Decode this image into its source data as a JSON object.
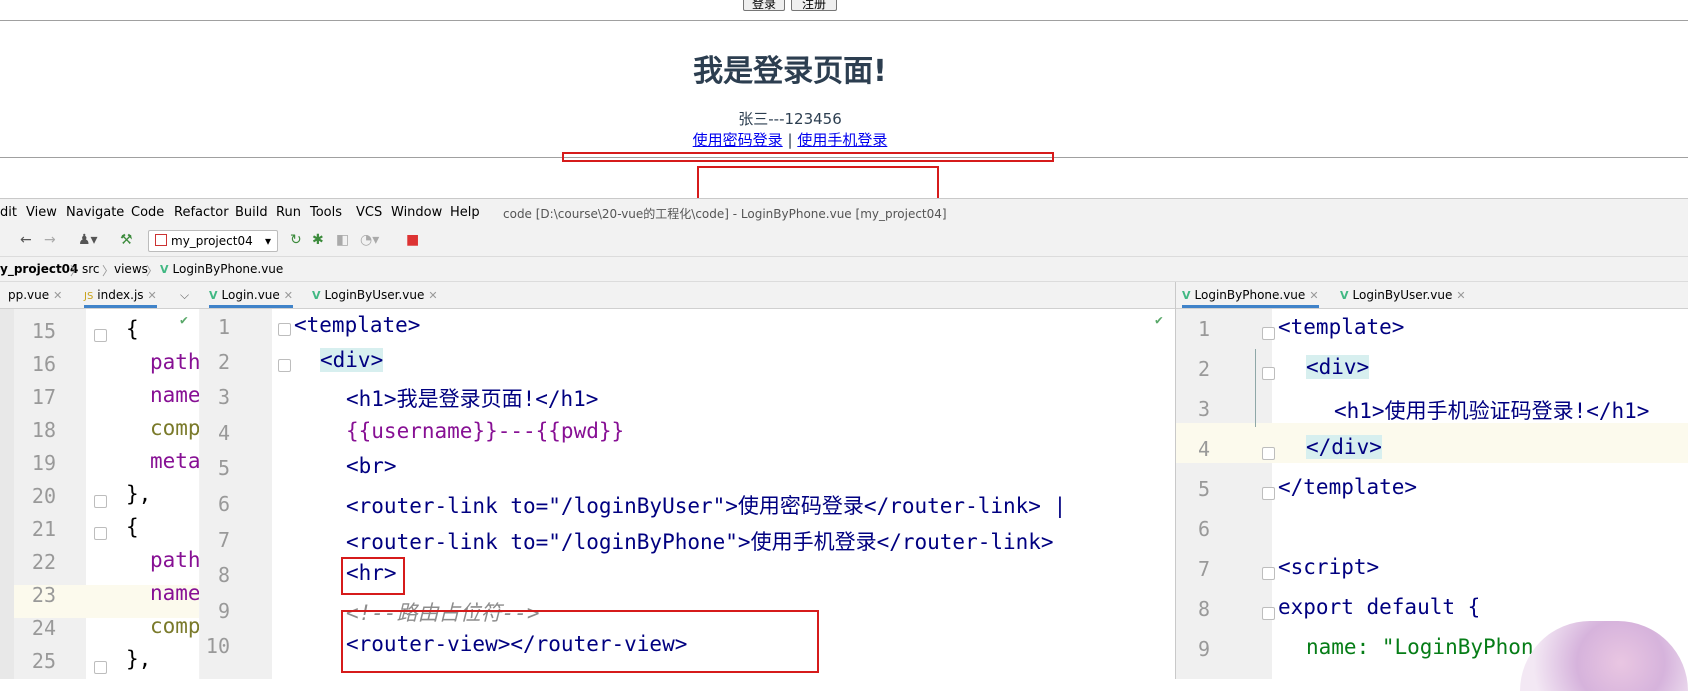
{
  "browser": {
    "login_button": "登录",
    "register_button": "注册",
    "heading": "我是登录页面!",
    "user_line": "张三---123456",
    "link_password": "使用密码登录",
    "link_separator": "|",
    "link_phone": "使用手机登录"
  },
  "ide": {
    "menu": [
      "dit",
      "View",
      "Navigate",
      "Code",
      "Refactor",
      "Build",
      "Run",
      "Tools",
      "VCS",
      "Window",
      "Help"
    ],
    "title": "code [D:\\course\\20-vue的工程化\\code] - LoginByPhone.vue [my_project04]",
    "run_config": "my_project04",
    "breadcrumb": [
      "y_project04",
      "src",
      "views",
      "LoginByPhone.vue"
    ],
    "left_tabs": [
      "pp.vue",
      "index.js"
    ],
    "middle_tabs": [
      "Login.vue",
      "LoginByUser.vue"
    ],
    "right_tabs": [
      "LoginByPhone.vue",
      "LoginByUser.vue"
    ],
    "left_editor": {
      "lines": [
        {
          "n": "15",
          "text": "{"
        },
        {
          "n": "16",
          "text": "path"
        },
        {
          "n": "17",
          "text": "name"
        },
        {
          "n": "18",
          "text": "comp"
        },
        {
          "n": "19",
          "text": "meta"
        },
        {
          "n": "20",
          "text": "},"
        },
        {
          "n": "21",
          "text": "{"
        },
        {
          "n": "22",
          "text": "path"
        },
        {
          "n": "23",
          "text": "name"
        },
        {
          "n": "24",
          "text": "comp"
        },
        {
          "n": "25",
          "text": "},"
        }
      ]
    },
    "middle_editor": {
      "lines": [
        {
          "n": "1",
          "text": "<template>"
        },
        {
          "n": "2",
          "text": "<div>"
        },
        {
          "n": "3",
          "text": "<h1>我是登录页面!</h1>"
        },
        {
          "n": "4",
          "text": "{{username}}---{{pwd}}"
        },
        {
          "n": "5",
          "text": "<br>"
        },
        {
          "n": "6",
          "text": "<router-link to=\"/loginByUser\">使用密码登录</router-link> |"
        },
        {
          "n": "7",
          "text": "<router-link to=\"/loginByPhone\">使用手机登录</router-link>"
        },
        {
          "n": "8",
          "text": "<hr>"
        },
        {
          "n": "9",
          "text": "<!--路由占位符-->"
        },
        {
          "n": "10",
          "text": "<router-view></router-view>"
        }
      ]
    },
    "right_editor": {
      "lines": [
        {
          "n": "1",
          "text": "<template>"
        },
        {
          "n": "2",
          "text": "<div>"
        },
        {
          "n": "3",
          "text": "<h1>使用手机验证码登录!</h1>"
        },
        {
          "n": "4",
          "text": "</div>"
        },
        {
          "n": "5",
          "text": "</template>"
        },
        {
          "n": "6",
          "text": ""
        },
        {
          "n": "7",
          "text": "<script>"
        },
        {
          "n": "8",
          "text": "export default {"
        },
        {
          "n": "9",
          "text": "name: \"LoginByPhon"
        }
      ]
    }
  },
  "colors": {
    "highlight_box": "#d61b1b",
    "vue_icon": "#41b883",
    "active_tab": "#4083c9"
  }
}
